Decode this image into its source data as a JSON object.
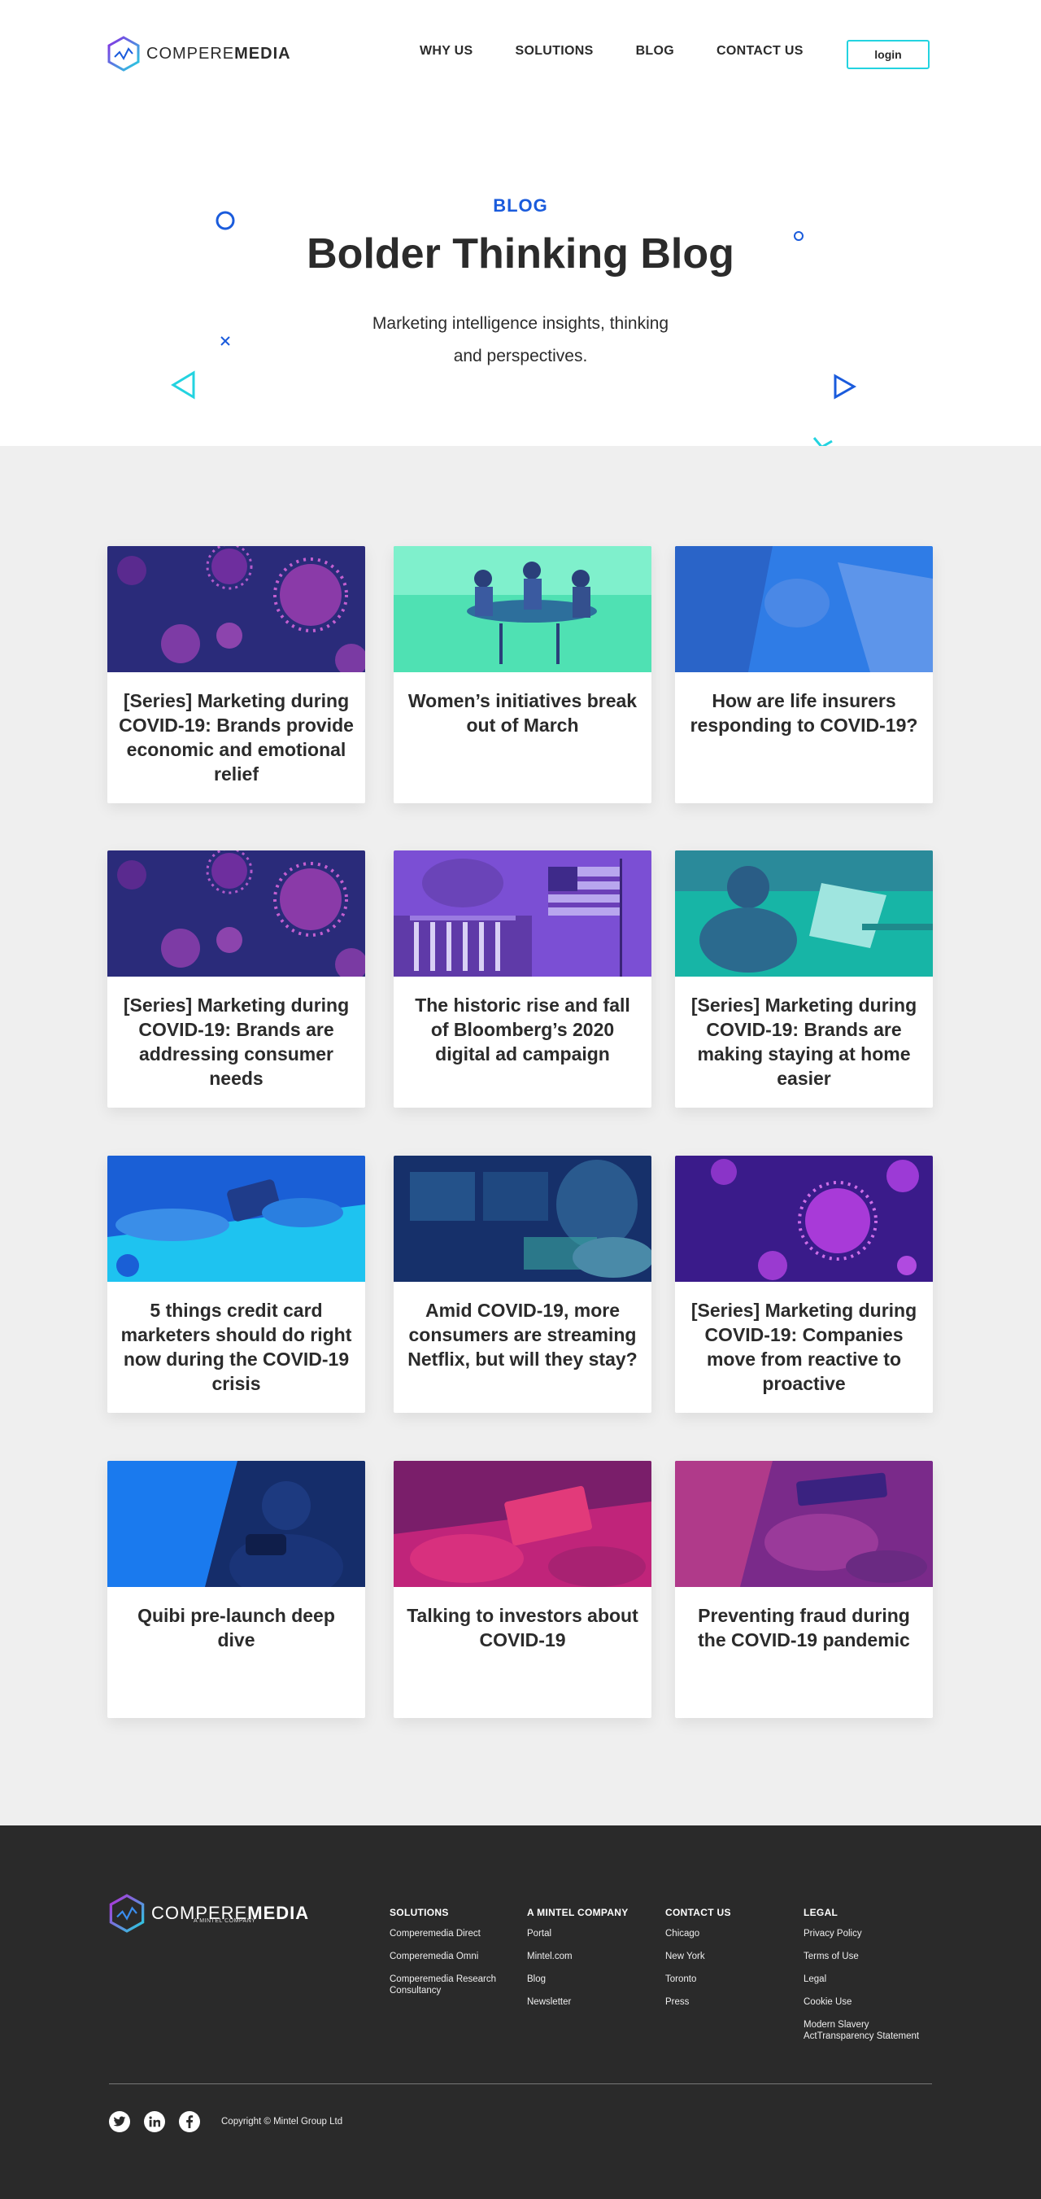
{
  "header": {
    "logo": {
      "text_light": "COMPERE",
      "text_bold": "MEDIA"
    },
    "nav": [
      {
        "label": "WHY US"
      },
      {
        "label": "SOLUTIONS"
      },
      {
        "label": "BLOG"
      },
      {
        "label": "CONTACT US"
      }
    ],
    "login_label": "login"
  },
  "hero": {
    "eyebrow": "BLOG",
    "title": "Bolder Thinking Blog",
    "subtitle": "Marketing intelligence insights, thinking and perspectives."
  },
  "posts": [
    {
      "title": "[Series] Marketing during COVID-19: Brands provide economic and emotional relief"
    },
    {
      "title": "Women’s initiatives break out of March"
    },
    {
      "title": "How are life insurers responding to COVID-19?"
    },
    {
      "title": "[Series] Marketing during COVID-19: Brands are addressing consumer needs"
    },
    {
      "title": "The historic rise and fall of Bloomberg’s 2020 digital ad campaign"
    },
    {
      "title": "[Series] Marketing during COVID-19: Brands are making staying at home easier"
    },
    {
      "title": "5 things credit card marketers should do right now during the COVID-19 crisis"
    },
    {
      "title": "Amid COVID-19, more consumers are streaming Netflix, but will they stay?"
    },
    {
      "title": "[Series] Marketing during COVID-19: Companies move from reactive to proactive"
    },
    {
      "title": "Quibi pre-launch deep dive"
    },
    {
      "title": "Talking to investors about COVID-19"
    },
    {
      "title": "Preventing fraud during the COVID-19 pandemic"
    }
  ],
  "footer": {
    "logo": {
      "text_light": "COMPERE",
      "text_bold": "MEDIA",
      "tagline": "A MINTEL COMPANY"
    },
    "columns": [
      {
        "heading": "SOLUTIONS",
        "links": [
          "Comperemedia Direct",
          "Comperemedia Omni",
          "Comperemedia Research Consultancy"
        ]
      },
      {
        "heading": "A MINTEL COMPANY",
        "links": [
          "Portal",
          "Mintel.com",
          "Blog",
          "Newsletter"
        ]
      },
      {
        "heading": "CONTACT US",
        "links": [
          "Chicago",
          "New York",
          "Toronto",
          "Press"
        ]
      },
      {
        "heading": "LEGAL",
        "links": [
          "Privacy Policy",
          "Terms of Use",
          "Legal",
          "Cookie Use",
          "Modern Slavery ActTransparency Statement"
        ]
      }
    ],
    "copyright": "Copyright © Mintel Group Ltd"
  },
  "colors": {
    "accent_blue": "#1a5bdc",
    "accent_cyan": "#23d3e0",
    "footer_bg": "#2a2a2a",
    "grid_bg": "#efefef"
  }
}
